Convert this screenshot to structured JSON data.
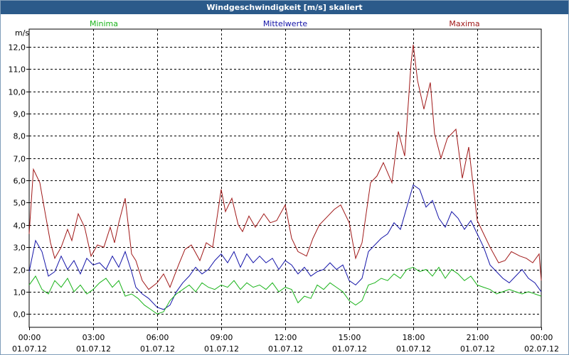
{
  "window": {
    "title": "Windgeschwindigkeit [m/s] skaliert"
  },
  "colors": {
    "minima": "#1ab31a",
    "mittelwerte": "#1414a8",
    "maxima": "#a01818",
    "grid": "#000000"
  },
  "chart_data": {
    "type": "line",
    "title": "Windgeschwindigkeit [m/s] skaliert",
    "ylabel": "m/s",
    "ylim": [
      -0.6,
      12.8
    ],
    "xlim": [
      0,
      24
    ],
    "yticks": [
      "0,0",
      "1,0",
      "2,0",
      "3,0",
      "4,0",
      "5,0",
      "6,0",
      "7,0",
      "8,0",
      "9,0",
      "10,0",
      "11,0",
      "12,0"
    ],
    "xticks": [
      {
        "time": "00:00",
        "date": "01.07.12"
      },
      {
        "time": "03:00",
        "date": "01.07.12"
      },
      {
        "time": "06:00",
        "date": "01.07.12"
      },
      {
        "time": "09:00",
        "date": "01.07.12"
      },
      {
        "time": "12:00",
        "date": "01.07.12"
      },
      {
        "time": "15:00",
        "date": "01.07.12"
      },
      {
        "time": "18:00",
        "date": "01.07.12"
      },
      {
        "time": "21:00",
        "date": "01.07.12"
      },
      {
        "time": "00:00",
        "date": "02.07.12"
      }
    ],
    "legend": [
      "Minima",
      "Mittelwerte",
      "Maxima"
    ],
    "grid": true,
    "series": [
      {
        "name": "Maxima",
        "x": [
          0,
          0.2,
          0.5,
          0.7,
          1,
          1.2,
          1.5,
          1.8,
          2,
          2.3,
          2.6,
          2.9,
          3.2,
          3.5,
          3.8,
          4,
          4.2,
          4.5,
          4.8,
          5,
          5.3,
          5.6,
          6,
          6.3,
          6.6,
          7,
          7.3,
          7.6,
          8,
          8.3,
          8.6,
          9,
          9.2,
          9.5,
          9.8,
          10,
          10.3,
          10.6,
          11,
          11.3,
          11.6,
          12,
          12.3,
          12.6,
          13,
          13.3,
          13.6,
          14,
          14.3,
          14.6,
          15,
          15.3,
          15.6,
          16,
          16.3,
          16.6,
          17,
          17.3,
          17.6,
          17.9,
          18,
          18.2,
          18.5,
          18.8,
          19,
          19.3,
          19.6,
          20,
          20.3,
          20.6,
          21,
          21.3,
          21.6,
          22,
          22.3,
          22.6,
          23,
          23.3,
          23.6,
          23.9,
          24
        ],
        "values": [
          3.6,
          6.5,
          5.9,
          4.8,
          3.2,
          2.5,
          3.0,
          3.8,
          3.3,
          4.5,
          3.9,
          2.6,
          3.1,
          3.0,
          3.9,
          3.2,
          4.1,
          5.2,
          2.7,
          2.4,
          1.5,
          1.1,
          1.4,
          1.8,
          1.2,
          2.2,
          2.9,
          3.1,
          2.4,
          3.2,
          3.0,
          5.6,
          4.6,
          5.2,
          4.0,
          3.7,
          4.4,
          3.9,
          4.5,
          4.1,
          4.2,
          4.9,
          3.4,
          2.8,
          2.6,
          3.4,
          4.0,
          4.4,
          4.7,
          4.9,
          4.1,
          2.5,
          3.2,
          5.9,
          6.2,
          6.8,
          5.9,
          8.2,
          7.1,
          11.3,
          12.1,
          10.5,
          9.2,
          10.4,
          8.1,
          7.0,
          7.9,
          8.3,
          6.1,
          7.5,
          4.2,
          3.6,
          3.0,
          2.3,
          2.4,
          2.8,
          2.6,
          2.5,
          2.3,
          2.7,
          1.5
        ]
      },
      {
        "name": "Mittelwerte",
        "x": [
          0,
          0.3,
          0.6,
          0.9,
          1.2,
          1.5,
          1.8,
          2.1,
          2.4,
          2.7,
          3,
          3.3,
          3.6,
          3.9,
          4.2,
          4.5,
          4.8,
          5,
          5.3,
          5.6,
          6,
          6.3,
          6.6,
          6.9,
          7.2,
          7.5,
          7.8,
          8.1,
          8.4,
          8.7,
          9,
          9.3,
          9.6,
          9.9,
          10.2,
          10.5,
          10.8,
          11.1,
          11.4,
          11.7,
          12,
          12.3,
          12.6,
          12.9,
          13.2,
          13.5,
          13.8,
          14.1,
          14.4,
          14.7,
          15,
          15.3,
          15.6,
          15.9,
          16.2,
          16.5,
          16.8,
          17.1,
          17.4,
          17.7,
          18,
          18.3,
          18.6,
          18.9,
          19.2,
          19.5,
          19.8,
          20.1,
          20.4,
          20.7,
          21,
          21.3,
          21.6,
          21.9,
          22.2,
          22.5,
          22.8,
          23.1,
          23.4,
          23.7,
          24
        ],
        "values": [
          1.9,
          3.3,
          2.8,
          1.7,
          1.9,
          2.6,
          2.0,
          2.4,
          1.8,
          2.5,
          2.2,
          2.3,
          2.0,
          2.6,
          2.1,
          2.8,
          1.9,
          1.2,
          0.9,
          0.7,
          0.3,
          0.2,
          0.4,
          1.0,
          1.4,
          1.7,
          2.1,
          1.8,
          2.0,
          2.4,
          2.7,
          2.3,
          2.8,
          2.1,
          2.7,
          2.3,
          2.6,
          2.3,
          2.5,
          2.0,
          2.4,
          2.2,
          1.8,
          2.1,
          1.7,
          1.9,
          2.0,
          2.3,
          2.0,
          2.2,
          1.5,
          1.3,
          1.6,
          2.8,
          3.1,
          3.4,
          3.6,
          4.1,
          3.8,
          4.8,
          5.8,
          5.6,
          4.8,
          5.1,
          4.3,
          3.9,
          4.6,
          4.3,
          3.8,
          4.2,
          3.6,
          3.0,
          2.2,
          1.9,
          1.6,
          1.4,
          1.7,
          2.0,
          1.6,
          1.4,
          1.0
        ]
      },
      {
        "name": "Minima",
        "x": [
          0,
          0.3,
          0.6,
          0.9,
          1.2,
          1.5,
          1.8,
          2.1,
          2.4,
          2.7,
          3,
          3.3,
          3.6,
          3.9,
          4.2,
          4.5,
          4.8,
          5.1,
          5.4,
          5.7,
          6,
          6.3,
          6.6,
          6.9,
          7.2,
          7.5,
          7.8,
          8.1,
          8.4,
          8.7,
          9,
          9.3,
          9.6,
          9.9,
          10.2,
          10.5,
          10.8,
          11.1,
          11.4,
          11.7,
          12,
          12.3,
          12.6,
          12.9,
          13.2,
          13.5,
          13.8,
          14.1,
          14.4,
          14.7,
          15,
          15.3,
          15.6,
          15.9,
          16.2,
          16.5,
          16.8,
          17.1,
          17.4,
          17.7,
          18,
          18.3,
          18.6,
          18.9,
          19.2,
          19.5,
          19.8,
          20.1,
          20.4,
          20.7,
          21,
          21.3,
          21.6,
          21.9,
          22.2,
          22.5,
          22.8,
          23.1,
          23.4,
          23.7,
          24
        ],
        "values": [
          1.3,
          1.7,
          1.1,
          0.9,
          1.5,
          1.2,
          1.6,
          1.0,
          1.3,
          0.9,
          1.1,
          1.4,
          1.6,
          1.2,
          1.5,
          0.8,
          0.9,
          0.7,
          0.4,
          0.2,
          0.0,
          0.1,
          0.6,
          0.9,
          1.1,
          1.3,
          1.0,
          1.4,
          1.2,
          1.1,
          1.3,
          1.2,
          1.5,
          1.1,
          1.4,
          1.2,
          1.3,
          1.1,
          1.4,
          1.0,
          1.2,
          1.1,
          0.5,
          0.8,
          0.7,
          1.3,
          1.1,
          1.4,
          1.2,
          1.0,
          0.6,
          0.4,
          0.6,
          1.3,
          1.4,
          1.6,
          1.5,
          1.8,
          1.6,
          2.0,
          2.1,
          1.9,
          2.0,
          1.7,
          2.1,
          1.6,
          2.0,
          1.8,
          1.5,
          1.7,
          1.3,
          1.2,
          1.1,
          0.9,
          1.0,
          1.1,
          1.0,
          0.9,
          1.0,
          0.9,
          0.8
        ]
      }
    ]
  }
}
